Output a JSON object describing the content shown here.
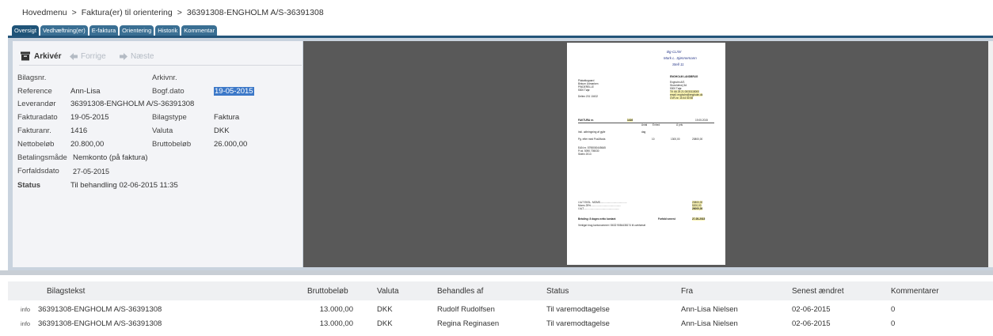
{
  "breadcrumb": {
    "items": [
      "Hovedmenu",
      "Faktura(er) til orientering",
      "36391308-ENGHOLM A/S-36391308"
    ],
    "separator": ">"
  },
  "tabs": [
    "Oversigt",
    "Vedhæftning(er)",
    "E-faktura",
    "Orientering",
    "Historik",
    "Kommentar"
  ],
  "toolbar": {
    "archive_label": "Arkivér",
    "prev_label": "Forrige",
    "next_label": "Næste"
  },
  "fields": {
    "bilagsnr_label": "Bilagsnr.",
    "arkivnr_label": "Arkivnr.",
    "reference_label": "Reference",
    "reference_value": "Ann-Lisa",
    "bogfdato_label": "Bogf.dato",
    "bogfdato_value": "19-05-2015",
    "leverandor_label": "Leverandør",
    "leverandor_value": "36391308-ENGHOLM A/S-36391308",
    "fakturadato_label": "Fakturadato",
    "fakturadato_value": "19-05-2015",
    "bilagstype_label": "Bilagstype",
    "bilagstype_value": "Faktura",
    "fakturanr_label": "Fakturanr.",
    "fakturanr_value": "1416",
    "valuta_label": "Valuta",
    "valuta_value": "DKK",
    "netto_label": "Nettobeløb",
    "netto_value": "20.800,00",
    "brutto_label": "Bruttobeløb",
    "brutto_value": "26.000,00",
    "betaling_label": "Betalingsmåde",
    "betaling_value": "Nemkonto (på faktura)",
    "forfald_label": "Forfaldsdato",
    "forfald_value": "27-05-2015",
    "status_label": "Status",
    "status_value": "Til behandling 02-06-2015 11:35"
  },
  "document": {
    "handwriting": [
      "Bg-CL/W",
      "Mark L. Sjønnemann",
      "Stell 11"
    ],
    "company": "ENGHOLM LANDBRUG",
    "left_block": [
      "Plakatkogaard",
      "Birkum Udmarken",
      "PINDERELLE",
      "5300 Tøjø",
      "",
      "Deltex 201 10432"
    ],
    "right_block": [
      "Engholm A/S",
      "Skovridevej 3A",
      "5300 Tøjø",
      "Tlf. 66 25 21 00/30115000",
      "email: engholm@engholm.dk",
      "CVR-nr. 15 44 50 58"
    ],
    "faktura_label": "FAKTURA nr.",
    "faktura_nr": "1416",
    "faktura_date": "19.05.2015",
    "cols": [
      "Antal",
      "Enhed",
      "À pris"
    ],
    "line1": "Inkl. udbringning af gylle",
    "line1_unit": "dag",
    "line2": "Pg. efter med Pos/Maria",
    "line2_qty": "10",
    "line2_price": "1300,00",
    "line2_total": "20800,00",
    "bank_lines": [
      "EAN nr. 5798000445645",
      "Fr.st. 5090 705030",
      "Skelin 2013"
    ],
    "totals_labels": [
      "I ALT EKSL. MOMS......................................",
      "Moms 25%...........................................",
      "I ALT..................................................."
    ],
    "totals_values": [
      "20800,00",
      "5200,00",
      "26000,00"
    ],
    "betaling_line": "Betaling: 8 dages netto kontant",
    "forfald_label": "Forfald senest",
    "forfald_value": "27-05-2015",
    "bank_line": "Venligst brug kontonummer i 5632 9084438174 til overførsel"
  },
  "grid": {
    "headers": {
      "bilagstekst": "Bilagstekst",
      "brutto": "Bruttobeløb",
      "valuta": "Valuta",
      "behandles": "Behandles af",
      "status": "Status",
      "fra": "Fra",
      "senest": "Senest ændret",
      "kommentarer": "Kommentarer"
    },
    "rows": [
      {
        "info": "info",
        "tekst": "36391308-ENGHOLM A/S-36391308",
        "brutto": "13.000,00",
        "valuta": "DKK",
        "behandles": "Rudolf Rudolfsen",
        "status": "Til varemodtagelse",
        "fra": "Ann-Lisa Nielsen",
        "senest": "02-06-2015",
        "kommentarer": "0"
      },
      {
        "info": "info",
        "tekst": "36391308-ENGHOLM A/S-36391308",
        "brutto": "13.000,00",
        "valuta": "DKK",
        "behandles": "Regina Reginasen",
        "status": "Til varemodtagelse",
        "fra": "Ann-Lisa Nielsen",
        "senest": "02-06-2015",
        "kommentarer": "0"
      }
    ]
  }
}
